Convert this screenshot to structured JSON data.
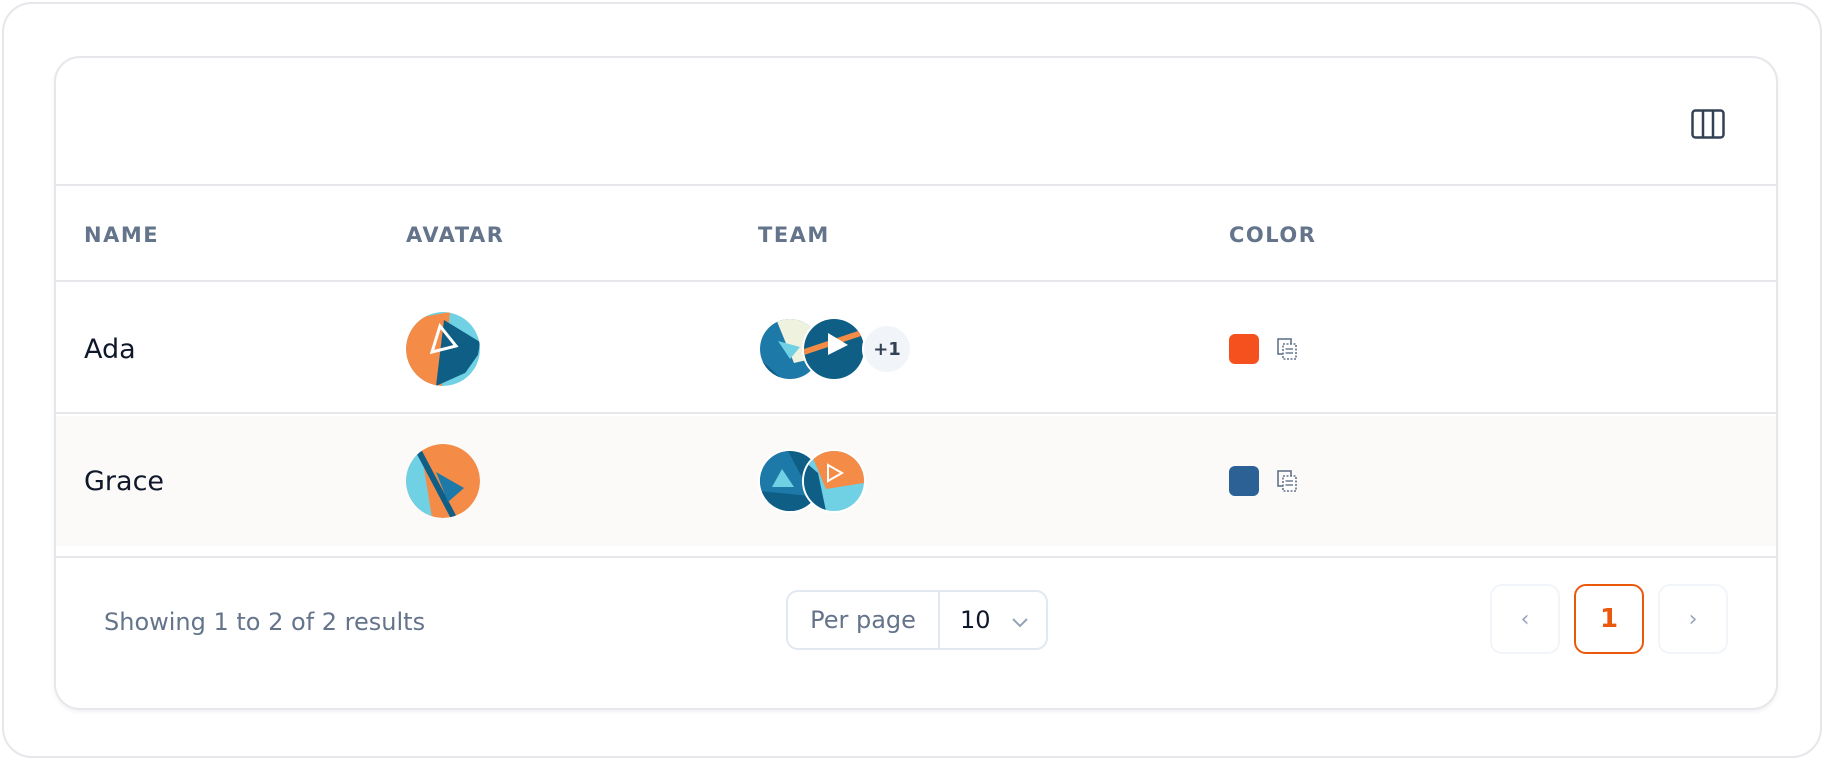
{
  "table": {
    "columns": [
      "NAME",
      "AVATAR",
      "TEAM",
      "COLOR"
    ],
    "rows": [
      {
        "name": "Ada",
        "avatar": "avatar-ada",
        "team": [
          "team-member-1",
          "team-member-2"
        ],
        "team_more": "+1",
        "color": "#F4511E"
      },
      {
        "name": "Grace",
        "avatar": "avatar-grace",
        "team": [
          "team-member-3",
          "team-member-4"
        ],
        "color": "#2B6195"
      }
    ]
  },
  "toolbar": {
    "columns_icon": "columns-icon"
  },
  "footer": {
    "summary": "Showing 1 to 2 of 2 results",
    "per_page_label": "Per page",
    "per_page_value": "10",
    "pagination": {
      "prev": "‹",
      "current": "1",
      "next": "›"
    }
  },
  "colors": {
    "accent": "#EA580C",
    "navy": "#0E5E86",
    "teal": "#1D79A8",
    "orange": "#F48C48",
    "sky": "#6FD1E3",
    "cream": "#EFF2DE"
  }
}
